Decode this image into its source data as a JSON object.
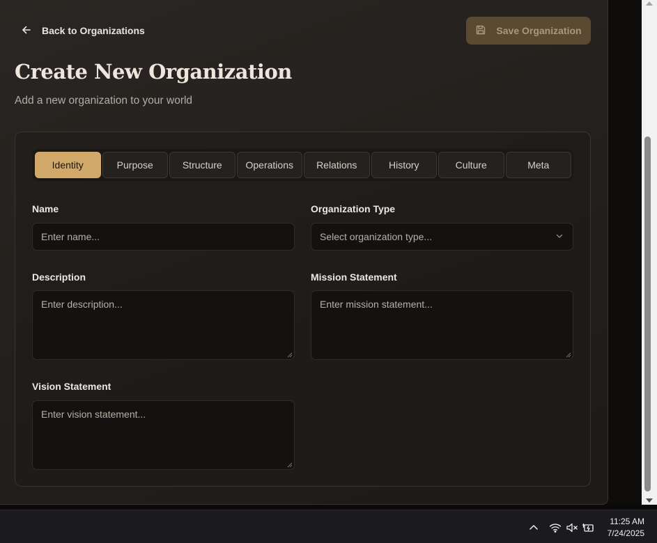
{
  "header": {
    "back_label": "Back to Organizations",
    "save_label": "Save Organization",
    "title": "Create New Organization",
    "subtitle": "Add a new organization to your world"
  },
  "tabs": [
    {
      "label": "Identity",
      "active": true
    },
    {
      "label": "Purpose",
      "active": false
    },
    {
      "label": "Structure",
      "active": false
    },
    {
      "label": "Operations",
      "active": false
    },
    {
      "label": "Relations",
      "active": false
    },
    {
      "label": "History",
      "active": false
    },
    {
      "label": "Culture",
      "active": false
    },
    {
      "label": "Meta",
      "active": false
    }
  ],
  "form": {
    "name": {
      "label": "Name",
      "placeholder": "Enter name...",
      "value": ""
    },
    "org_type": {
      "label": "Organization Type",
      "placeholder": "Select organization type..."
    },
    "description": {
      "label": "Description",
      "placeholder": "Enter description..."
    },
    "mission": {
      "label": "Mission Statement",
      "placeholder": "Enter mission statement..."
    },
    "vision": {
      "label": "Vision Statement",
      "placeholder": "Enter vision statement..."
    }
  },
  "taskbar": {
    "time": "11:25 AM",
    "date": "7/24/2025",
    "icons": [
      "chevron-up-icon",
      "wifi-icon",
      "speaker-muted-icon",
      "battery-charging-icon"
    ]
  },
  "colors": {
    "accent": "#cfa86a",
    "save_button_bg": "#5a4a32",
    "background": "#25221f",
    "field_bg": "#141211"
  }
}
